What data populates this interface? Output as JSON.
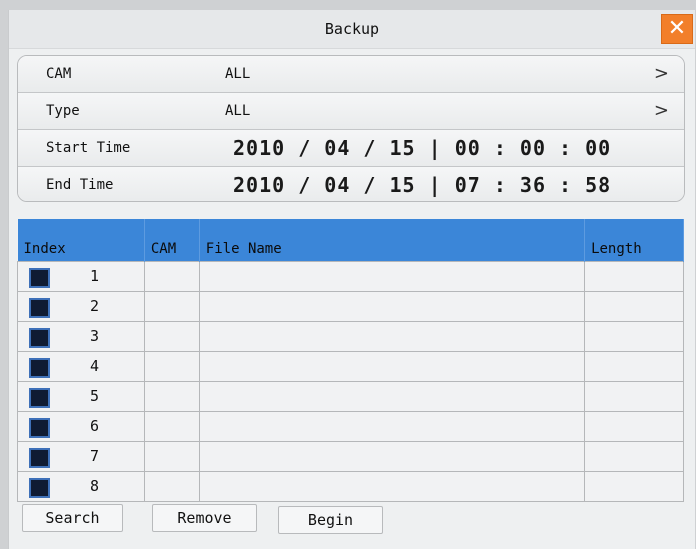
{
  "window": {
    "title": "Backup",
    "close_icon": "close-icon",
    "accent": "#f27f2a"
  },
  "settings": {
    "cam": {
      "label": "CAM",
      "value": "ALL"
    },
    "type": {
      "label": "Type",
      "value": "ALL"
    },
    "start_time": {
      "label": "Start Time",
      "value": "2010 / 04 / 15 | 00 : 00 : 00"
    },
    "end_time": {
      "label": "End Time",
      "value": "2010 / 04 / 15 | 07 : 36 : 58"
    },
    "arrow": ">"
  },
  "table": {
    "header_color": "#3b86d8",
    "columns": {
      "index": "Index",
      "cam": "CAM",
      "file_name": "File Name",
      "length": "Length"
    },
    "rows": [
      "1",
      "2",
      "3",
      "4",
      "5",
      "6",
      "7",
      "8"
    ]
  },
  "buttons": {
    "search": "Search",
    "remove": "Remove",
    "begin": "Begin"
  }
}
